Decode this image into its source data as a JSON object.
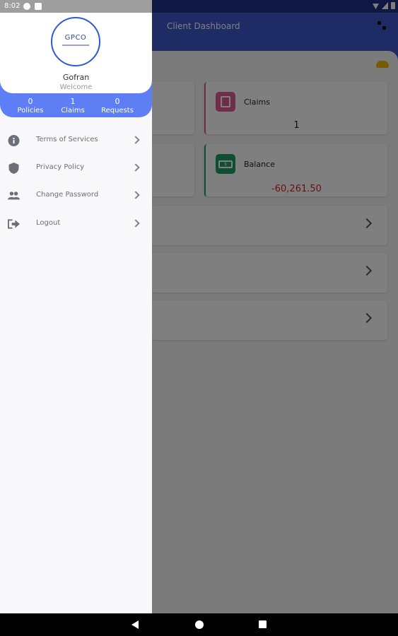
{
  "status_bar": {
    "time": "8:02"
  },
  "app": {
    "title": "Client Dashboard",
    "cards": [
      {
        "label": "Claims",
        "value": "1"
      },
      {
        "label": "Balance",
        "value": "-60,261.50",
        "icon_text": "$"
      }
    ]
  },
  "drawer": {
    "logo_text": "GPCO",
    "user_name": "Gofran",
    "welcome": "Welcome",
    "stats": [
      {
        "count": "0",
        "label": "Policies"
      },
      {
        "count": "1",
        "label": "Claims"
      },
      {
        "count": "0",
        "label": "Requests"
      }
    ],
    "menu": [
      {
        "label": "Terms of Services",
        "icon": "info-icon"
      },
      {
        "label": "Privacy Policy",
        "icon": "shield-icon"
      },
      {
        "label": "Change Password",
        "icon": "users-icon"
      },
      {
        "label": "Logout",
        "icon": "logout-icon"
      }
    ]
  },
  "colors": {
    "primary": "#3f57c9",
    "drawer_accent": "#5e7ef5",
    "claims_accent": "#e05d8c",
    "balance_accent": "#1f9d65",
    "negative": "#d92020"
  }
}
